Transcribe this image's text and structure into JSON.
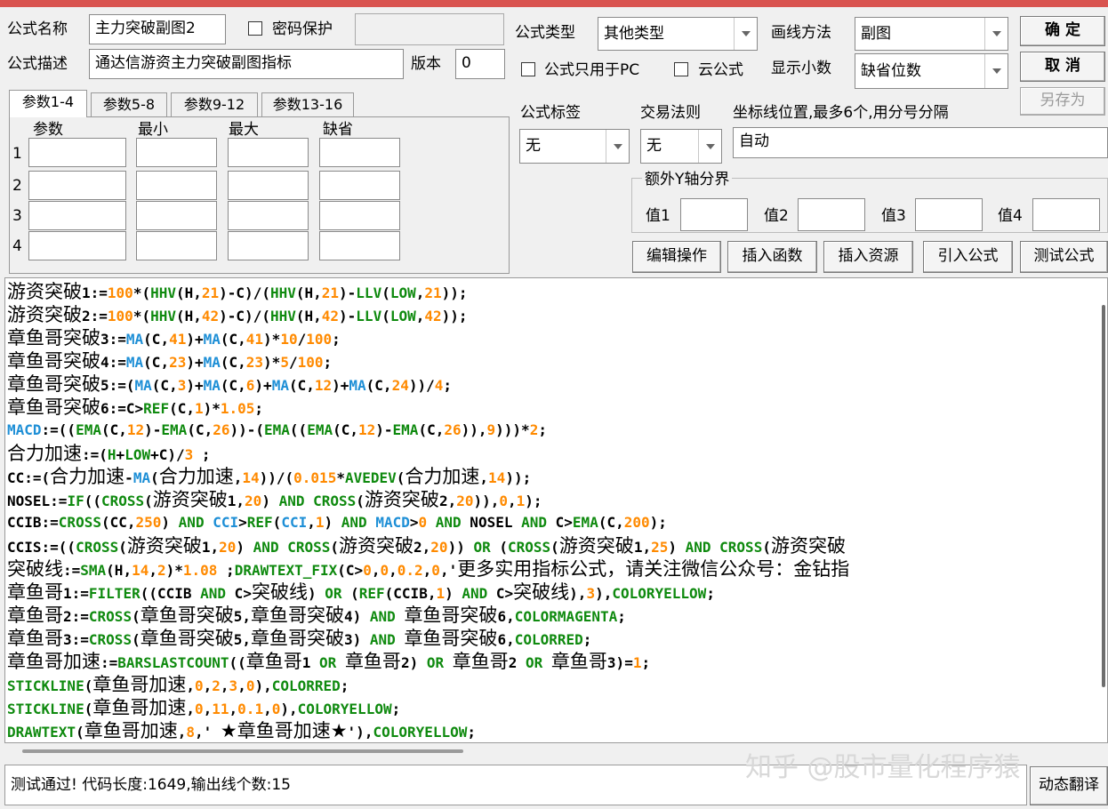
{
  "form": {
    "name_label": "公式名称",
    "name_value": "主力突破副图2",
    "password_label": "密码保护",
    "desc_label": "公式描述",
    "desc_value": "通达信游资主力突破副图指标",
    "version_label": "版本",
    "version_value": "0",
    "type_label": "公式类型",
    "type_value": "其他类型",
    "pc_only_label": "公式只用于PC",
    "cloud_label": "云公式",
    "draw_method_label": "画线方法",
    "draw_method_value": "副图",
    "decimals_label": "显示小数",
    "decimals_value": "缺省位数",
    "tag_label": "公式标签",
    "tag_value": "无",
    "trade_rule_label": "交易法则",
    "trade_rule_value": "无",
    "axis_label": "坐标线位置,最多6个,用分号分隔",
    "axis_value": "自动",
    "extra_y_label": "额外Y轴分界",
    "val1_label": "值1",
    "val2_label": "值2",
    "val3_label": "值3",
    "val4_label": "值4"
  },
  "buttons": {
    "ok": "确  定",
    "cancel": "取  消",
    "save_as": "另存为",
    "edit_ops": "编辑操作",
    "insert_func": "插入函数",
    "insert_res": "插入资源",
    "import_formula": "引入公式",
    "test_formula": "测试公式",
    "dynamic_translate": "动态翻译"
  },
  "tabs": [
    "参数1-4",
    "参数5-8",
    "参数9-12",
    "参数13-16"
  ],
  "params": {
    "headers": [
      "参数",
      "最小",
      "最大",
      "缺省"
    ],
    "rows": [
      "1",
      "2",
      "3",
      "4"
    ]
  },
  "code_lines": [
    [
      [
        "cn",
        "游资突破"
      ],
      [
        "tx",
        "1:="
      ],
      [
        "nm",
        "100"
      ],
      [
        "tx",
        "*("
      ],
      [
        "kw",
        "HHV"
      ],
      [
        "tx",
        "(H,"
      ],
      [
        "nm",
        "21"
      ],
      [
        "tx",
        ")-C)/("
      ],
      [
        "kw",
        "HHV"
      ],
      [
        "tx",
        "(H,"
      ],
      [
        "nm",
        "21"
      ],
      [
        "tx",
        ")-"
      ],
      [
        "kw",
        "LLV"
      ],
      [
        "tx",
        "("
      ],
      [
        "kw",
        "LOW"
      ],
      [
        "tx",
        ","
      ],
      [
        "nm",
        "21"
      ],
      [
        "tx",
        "));"
      ]
    ],
    [
      [
        "cn",
        "游资突破"
      ],
      [
        "tx",
        "2:="
      ],
      [
        "nm",
        "100"
      ],
      [
        "tx",
        "*("
      ],
      [
        "kw",
        "HHV"
      ],
      [
        "tx",
        "(H,"
      ],
      [
        "nm",
        "42"
      ],
      [
        "tx",
        ")-C)/("
      ],
      [
        "kw",
        "HHV"
      ],
      [
        "tx",
        "(H,"
      ],
      [
        "nm",
        "42"
      ],
      [
        "tx",
        ")-"
      ],
      [
        "kw",
        "LLV"
      ],
      [
        "tx",
        "("
      ],
      [
        "kw",
        "LOW"
      ],
      [
        "tx",
        ","
      ],
      [
        "nm",
        "42"
      ],
      [
        "tx",
        "));"
      ]
    ],
    [
      [
        "cn",
        "章鱼哥突破"
      ],
      [
        "tx",
        "3:="
      ],
      [
        "fn",
        "MA"
      ],
      [
        "tx",
        "(C,"
      ],
      [
        "nm",
        "41"
      ],
      [
        "tx",
        ")+"
      ],
      [
        "fn",
        "MA"
      ],
      [
        "tx",
        "(C,"
      ],
      [
        "nm",
        "41"
      ],
      [
        "tx",
        ")*"
      ],
      [
        "nm",
        "10"
      ],
      [
        "tx",
        "/"
      ],
      [
        "nm",
        "100"
      ],
      [
        "tx",
        ";"
      ]
    ],
    [
      [
        "cn",
        "章鱼哥突破"
      ],
      [
        "tx",
        "4:="
      ],
      [
        "fn",
        "MA"
      ],
      [
        "tx",
        "(C,"
      ],
      [
        "nm",
        "23"
      ],
      [
        "tx",
        ")+"
      ],
      [
        "fn",
        "MA"
      ],
      [
        "tx",
        "(C,"
      ],
      [
        "nm",
        "23"
      ],
      [
        "tx",
        ")*"
      ],
      [
        "nm",
        "5"
      ],
      [
        "tx",
        "/"
      ],
      [
        "nm",
        "100"
      ],
      [
        "tx",
        ";"
      ]
    ],
    [
      [
        "cn",
        "章鱼哥突破"
      ],
      [
        "tx",
        "5:=("
      ],
      [
        "fn",
        "MA"
      ],
      [
        "tx",
        "(C,"
      ],
      [
        "nm",
        "3"
      ],
      [
        "tx",
        ")+"
      ],
      [
        "fn",
        "MA"
      ],
      [
        "tx",
        "(C,"
      ],
      [
        "nm",
        "6"
      ],
      [
        "tx",
        ")+"
      ],
      [
        "fn",
        "MA"
      ],
      [
        "tx",
        "(C,"
      ],
      [
        "nm",
        "12"
      ],
      [
        "tx",
        ")+"
      ],
      [
        "fn",
        "MA"
      ],
      [
        "tx",
        "(C,"
      ],
      [
        "nm",
        "24"
      ],
      [
        "tx",
        "))/"
      ],
      [
        "nm",
        "4"
      ],
      [
        "tx",
        ";"
      ]
    ],
    [
      [
        "cn",
        "章鱼哥突破"
      ],
      [
        "tx",
        "6:=C>"
      ],
      [
        "kw",
        "REF"
      ],
      [
        "tx",
        "(C,"
      ],
      [
        "nm",
        "1"
      ],
      [
        "tx",
        ")*"
      ],
      [
        "nm",
        "1.05"
      ],
      [
        "tx",
        ";"
      ]
    ],
    [
      [
        "fn",
        "MACD"
      ],
      [
        "tx",
        ":=(("
      ],
      [
        "kw",
        "EMA"
      ],
      [
        "tx",
        "(C,"
      ],
      [
        "nm",
        "12"
      ],
      [
        "tx",
        ")-"
      ],
      [
        "kw",
        "EMA"
      ],
      [
        "tx",
        "(C,"
      ],
      [
        "nm",
        "26"
      ],
      [
        "tx",
        "))-("
      ],
      [
        "kw",
        "EMA"
      ],
      [
        "tx",
        "(("
      ],
      [
        "kw",
        "EMA"
      ],
      [
        "tx",
        "(C,"
      ],
      [
        "nm",
        "12"
      ],
      [
        "tx",
        ")-"
      ],
      [
        "kw",
        "EMA"
      ],
      [
        "tx",
        "(C,"
      ],
      [
        "nm",
        "26"
      ],
      [
        "tx",
        ")),"
      ],
      [
        "nm",
        "9"
      ],
      [
        "tx",
        ")))*"
      ],
      [
        "nm",
        "2"
      ],
      [
        "tx",
        ";"
      ]
    ],
    [
      [
        "cn",
        "合力加速"
      ],
      [
        "tx",
        ":=("
      ],
      [
        "kw",
        "H"
      ],
      [
        "tx",
        "+"
      ],
      [
        "kw",
        "LOW"
      ],
      [
        "tx",
        "+C)/"
      ],
      [
        "nm",
        "3"
      ],
      [
        "tx",
        " ;"
      ]
    ],
    [
      [
        "tx",
        "CC:=("
      ],
      [
        "cn",
        "合力加速"
      ],
      [
        "tx",
        "-"
      ],
      [
        "fn",
        "MA"
      ],
      [
        "tx",
        "("
      ],
      [
        "cn",
        "合力加速"
      ],
      [
        "tx",
        ","
      ],
      [
        "nm",
        "14"
      ],
      [
        "tx",
        "))/("
      ],
      [
        "nm",
        "0.015"
      ],
      [
        "tx",
        "*"
      ],
      [
        "kw",
        "AVEDEV"
      ],
      [
        "tx",
        "("
      ],
      [
        "cn",
        "合力加速"
      ],
      [
        "tx",
        ","
      ],
      [
        "nm",
        "14"
      ],
      [
        "tx",
        "));"
      ]
    ],
    [
      [
        "tx",
        "NOSEL:="
      ],
      [
        "kw",
        "IF"
      ],
      [
        "tx",
        "(("
      ],
      [
        "kw",
        "CROSS"
      ],
      [
        "tx",
        "("
      ],
      [
        "cn",
        "游资突破"
      ],
      [
        "tx",
        "1,"
      ],
      [
        "nm",
        "20"
      ],
      [
        "tx",
        ") "
      ],
      [
        "kw",
        "AND"
      ],
      [
        "tx",
        " "
      ],
      [
        "kw",
        "CROSS"
      ],
      [
        "tx",
        "("
      ],
      [
        "cn",
        "游资突破"
      ],
      [
        "tx",
        "2,"
      ],
      [
        "nm",
        "20"
      ],
      [
        "tx",
        ")),"
      ],
      [
        "nm",
        "0"
      ],
      [
        "tx",
        ","
      ],
      [
        "nm",
        "1"
      ],
      [
        "tx",
        ");"
      ]
    ],
    [
      [
        "tx",
        "CCIB:="
      ],
      [
        "kw",
        "CROSS"
      ],
      [
        "tx",
        "(CC,"
      ],
      [
        "nm",
        "250"
      ],
      [
        "tx",
        ") "
      ],
      [
        "kw",
        "AND"
      ],
      [
        "tx",
        " "
      ],
      [
        "fn",
        "CCI"
      ],
      [
        "tx",
        ">"
      ],
      [
        "kw",
        "REF"
      ],
      [
        "tx",
        "("
      ],
      [
        "fn",
        "CCI"
      ],
      [
        "tx",
        ","
      ],
      [
        "nm",
        "1"
      ],
      [
        "tx",
        ") "
      ],
      [
        "kw",
        "AND"
      ],
      [
        "tx",
        " "
      ],
      [
        "fn",
        "MACD"
      ],
      [
        "tx",
        ">"
      ],
      [
        "nm",
        "0"
      ],
      [
        "tx",
        " "
      ],
      [
        "kw",
        "AND"
      ],
      [
        "tx",
        " NOSEL "
      ],
      [
        "kw",
        "AND"
      ],
      [
        "tx",
        " C>"
      ],
      [
        "kw",
        "EMA"
      ],
      [
        "tx",
        "(C,"
      ],
      [
        "nm",
        "200"
      ],
      [
        "tx",
        ");"
      ]
    ],
    [
      [
        "tx",
        "CCIS:=(("
      ],
      [
        "kw",
        "CROSS"
      ],
      [
        "tx",
        "("
      ],
      [
        "cn",
        "游资突破"
      ],
      [
        "tx",
        "1,"
      ],
      [
        "nm",
        "20"
      ],
      [
        "tx",
        ") "
      ],
      [
        "kw",
        "AND"
      ],
      [
        "tx",
        " "
      ],
      [
        "kw",
        "CROSS"
      ],
      [
        "tx",
        "("
      ],
      [
        "cn",
        "游资突破"
      ],
      [
        "tx",
        "2,"
      ],
      [
        "nm",
        "20"
      ],
      [
        "tx",
        ")) "
      ],
      [
        "kw",
        "OR"
      ],
      [
        "tx",
        " ("
      ],
      [
        "kw",
        "CROSS"
      ],
      [
        "tx",
        "("
      ],
      [
        "cn",
        "游资突破"
      ],
      [
        "tx",
        "1,"
      ],
      [
        "nm",
        "25"
      ],
      [
        "tx",
        ") "
      ],
      [
        "kw",
        "AND"
      ],
      [
        "tx",
        " "
      ],
      [
        "kw",
        "CROSS"
      ],
      [
        "tx",
        "("
      ],
      [
        "cn",
        "游资突破"
      ]
    ],
    [
      [
        "cn",
        "突破线"
      ],
      [
        "tx",
        ":="
      ],
      [
        "kw",
        "SMA"
      ],
      [
        "tx",
        "(H,"
      ],
      [
        "nm",
        "14"
      ],
      [
        "tx",
        ","
      ],
      [
        "nm",
        "2"
      ],
      [
        "tx",
        ")*"
      ],
      [
        "nm",
        "1.08"
      ],
      [
        "tx",
        " ;"
      ],
      [
        "kw",
        "DRAWTEXT_FIX"
      ],
      [
        "tx",
        "(C>"
      ],
      [
        "nm",
        "0"
      ],
      [
        "tx",
        ","
      ],
      [
        "nm",
        "0"
      ],
      [
        "tx",
        ","
      ],
      [
        "nm",
        "0.2"
      ],
      [
        "tx",
        ","
      ],
      [
        "nm",
        "0"
      ],
      [
        "tx",
        ",'"
      ],
      [
        "cn",
        "更多实用指标公式，请关注微信公众号：金钻指"
      ]
    ],
    [
      [
        "cn",
        "章鱼哥"
      ],
      [
        "tx",
        "1:="
      ],
      [
        "kw",
        "FILTER"
      ],
      [
        "tx",
        "((CCIB "
      ],
      [
        "kw",
        "AND"
      ],
      [
        "tx",
        " C>"
      ],
      [
        "cn",
        "突破线"
      ],
      [
        "tx",
        ") "
      ],
      [
        "kw",
        "OR"
      ],
      [
        "tx",
        " ("
      ],
      [
        "kw",
        "REF"
      ],
      [
        "tx",
        "(CCIB,"
      ],
      [
        "nm",
        "1"
      ],
      [
        "tx",
        ") "
      ],
      [
        "kw",
        "AND"
      ],
      [
        "tx",
        " C>"
      ],
      [
        "cn",
        "突破线"
      ],
      [
        "tx",
        "),"
      ],
      [
        "nm",
        "3"
      ],
      [
        "tx",
        "),"
      ],
      [
        "kw",
        "COLORYELLOW"
      ],
      [
        "tx",
        ";"
      ]
    ],
    [
      [
        "cn",
        "章鱼哥"
      ],
      [
        "tx",
        "2:="
      ],
      [
        "kw",
        "CROSS"
      ],
      [
        "tx",
        "("
      ],
      [
        "cn",
        "章鱼哥突破"
      ],
      [
        "tx",
        "5,"
      ],
      [
        "cn",
        "章鱼哥突破"
      ],
      [
        "tx",
        "4) "
      ],
      [
        "kw",
        "AND"
      ],
      [
        "tx",
        " "
      ],
      [
        "cn",
        "章鱼哥突破"
      ],
      [
        "tx",
        "6,"
      ],
      [
        "kw",
        "COLORMAGENTA"
      ],
      [
        "tx",
        ";"
      ]
    ],
    [
      [
        "cn",
        "章鱼哥"
      ],
      [
        "tx",
        "3:="
      ],
      [
        "kw",
        "CROSS"
      ],
      [
        "tx",
        "("
      ],
      [
        "cn",
        "章鱼哥突破"
      ],
      [
        "tx",
        "5,"
      ],
      [
        "cn",
        "章鱼哥突破"
      ],
      [
        "tx",
        "3) "
      ],
      [
        "kw",
        "AND"
      ],
      [
        "tx",
        " "
      ],
      [
        "cn",
        "章鱼哥突破"
      ],
      [
        "tx",
        "6,"
      ],
      [
        "kw",
        "COLORRED"
      ],
      [
        "tx",
        ";"
      ]
    ],
    [
      [
        "cn",
        "章鱼哥加速"
      ],
      [
        "tx",
        ":="
      ],
      [
        "kw",
        "BARSLASTCOUNT"
      ],
      [
        "tx",
        "(("
      ],
      [
        "cn",
        "章鱼哥"
      ],
      [
        "tx",
        "1 "
      ],
      [
        "kw",
        "OR"
      ],
      [
        "tx",
        " "
      ],
      [
        "cn",
        "章鱼哥"
      ],
      [
        "tx",
        "2) "
      ],
      [
        "kw",
        "OR"
      ],
      [
        "tx",
        " "
      ],
      [
        "cn",
        "章鱼哥"
      ],
      [
        "tx",
        "2 "
      ],
      [
        "kw",
        "OR"
      ],
      [
        "tx",
        " "
      ],
      [
        "cn",
        "章鱼哥"
      ],
      [
        "tx",
        "3)="
      ],
      [
        "nm",
        "1"
      ],
      [
        "tx",
        ";"
      ]
    ],
    [
      [
        "kw",
        "STICKLINE"
      ],
      [
        "tx",
        "("
      ],
      [
        "cn",
        "章鱼哥加速"
      ],
      [
        "tx",
        ","
      ],
      [
        "nm",
        "0"
      ],
      [
        "tx",
        ","
      ],
      [
        "nm",
        "2"
      ],
      [
        "tx",
        ","
      ],
      [
        "nm",
        "3"
      ],
      [
        "tx",
        ","
      ],
      [
        "nm",
        "0"
      ],
      [
        "tx",
        "),"
      ],
      [
        "kw",
        "COLORRED"
      ],
      [
        "tx",
        ";"
      ]
    ],
    [
      [
        "kw",
        "STICKLINE"
      ],
      [
        "tx",
        "("
      ],
      [
        "cn",
        "章鱼哥加速"
      ],
      [
        "tx",
        ","
      ],
      [
        "nm",
        "0"
      ],
      [
        "tx",
        ","
      ],
      [
        "nm",
        "11"
      ],
      [
        "tx",
        ","
      ],
      [
        "nm",
        "0.1"
      ],
      [
        "tx",
        ","
      ],
      [
        "nm",
        "0"
      ],
      [
        "tx",
        "),"
      ],
      [
        "kw",
        "COLORYELLOW"
      ],
      [
        "tx",
        ";"
      ]
    ],
    [
      [
        "kw",
        "DRAWTEXT"
      ],
      [
        "tx",
        "("
      ],
      [
        "cn",
        "章鱼哥加速"
      ],
      [
        "tx",
        ","
      ],
      [
        "nm",
        "8"
      ],
      [
        "tx",
        ",' "
      ],
      [
        "cn",
        "★章鱼哥加速★"
      ],
      [
        "tx",
        "'),"
      ],
      [
        "kw",
        "COLORYELLOW"
      ],
      [
        "tx",
        ";"
      ]
    ]
  ],
  "status": "测试通过! 代码长度:1649,输出线个数:15",
  "watermark": "知乎 @股市量化程序猿",
  "colors": {
    "keyword": "#0f8a0f",
    "function": "#1e8fd6",
    "number": "#ff8a00",
    "titlebar": "#d9534f"
  }
}
